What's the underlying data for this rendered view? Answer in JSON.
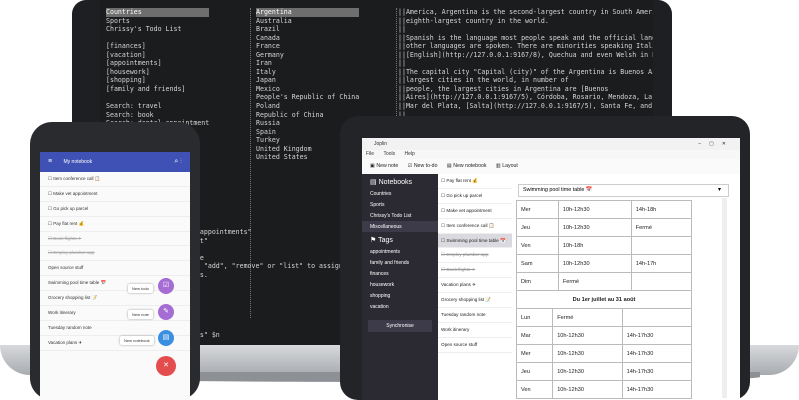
{
  "terminal": {
    "col1": [
      "Countries",
      "Sports",
      "Chrissy's Todo List",
      "",
      "[finances]",
      "[vacation]",
      "[appointments]",
      "[housework]",
      "[shopping]",
      "[family and friends]",
      "",
      "Search: travel",
      "Search: book",
      "Search: dental appointment"
    ],
    "col2": [
      "Argentina",
      "Australia",
      "Brazil",
      "Canada",
      "France",
      "Germany",
      "Iran",
      "Italy",
      "Japan",
      "Mexico",
      "People's Republic of China",
      "Poland",
      "Republic of China",
      "Russia",
      "Spain",
      "Turkey",
      "United Kingdom",
      "United States"
    ],
    "col3": [
      "||America, Argentina is the second-largest country in South America and the",
      "||eighth-largest country in the world.",
      "||",
      "||Spanish is the language most people speak and the official language, but many",
      "||other languages are spoken. There are minorities speaking Italian, German,",
      "||[English](http://127.0.0.1:9167/8), Quechua and even Welsh in Patagonia.",
      "||",
      "||The capital city \"Capital (city)\" of the Argentina is Buenos Aires, one of the",
      "||largest cities in the world, in number of",
      "||people, the largest cities in Argentina are [Buenos",
      "||Aires](http://127.0.0.1:9167/5), Córdoba, Rosario, Mendoza, La Plata, Tucumán,",
      "||Mar del Plata, [Salta](http://127.0.0.1:9167/5), Santa Fe, and Bahia Blanca.",
      "||",
      "||Argentina is between the Andes mountain range in the west and the southern"
    ],
    "bottom": [
      "ol appointments\"",
      "list\"",
      "",
      "note",
      "ype \"add\", \"remove\" or \"list\" to assign or",
      "tags.",
      "",
      "",
      "",
      "",
      "",
      "",
      "otes\" $n"
    ]
  },
  "tablet": {
    "app_title": "Joplin",
    "menu": [
      "File",
      "Tools",
      "Help"
    ],
    "toolbar": [
      "New note",
      "New to-do",
      "New notebook",
      "Layout"
    ],
    "sidebar": {
      "notebooks_header": "Notebooks",
      "notebooks": [
        "Countries",
        "Sports",
        "Chrissy's Todo List",
        "Miscellaneous"
      ],
      "tags_header": "Tags",
      "tags": [
        "appointments",
        "family and friends",
        "finances",
        "housework",
        "shopping",
        "vacation"
      ],
      "sync_button": "Synchronise"
    },
    "notes": [
      "Pay flat rent 💰",
      "Go pick up parcel",
      "Make vet appointment",
      "Item conference call 📋",
      "Swimming pool time table 📅",
      "Employ plumber app",
      "Book flights ✈",
      "Vacation plans ✈",
      "Grocery shopping list 📝",
      "Tuesday random note",
      "Work itinerary",
      "Open source stuff"
    ],
    "note_title": "Swimming pool time table 📅",
    "table1": [
      [
        "Mer",
        "10h-12h30",
        "14h-18h"
      ],
      [
        "Jeu",
        "10h-12h30",
        "Fermé"
      ],
      [
        "Ven",
        "10h-18h",
        ""
      ],
      [
        "Sam",
        "10h-12h30",
        "14h-17h"
      ],
      [
        "Dim",
        "Fermé",
        ""
      ]
    ],
    "table2_header": "Du 1er juillet au 31 août",
    "table2": [
      [
        "Lun",
        "Fermé",
        ""
      ],
      [
        "Mar",
        "10h-12h30",
        "14h-17h30"
      ],
      [
        "Mer",
        "10h-12h30",
        "14h-17h30"
      ],
      [
        "Jeu",
        "10h-12h30",
        "14h-17h30"
      ],
      [
        "Ven",
        "10h-12h30",
        "14h-17h30"
      ]
    ]
  },
  "phone": {
    "title": "My notebook",
    "items": [
      "Item conference call 📋",
      "Make vet appointment",
      "Go pick up parcel",
      "Pay flat rent 💰",
      "Book flights ✈",
      "Employ plumber app",
      "Open source stuff",
      "Swimming pool time table 📅",
      "Grocery shopping list 📝",
      "Work itinerary",
      "Tuesday random note",
      "Vacation plans ✈"
    ],
    "chips": [
      "New todo",
      "New note",
      "New notebook"
    ]
  }
}
